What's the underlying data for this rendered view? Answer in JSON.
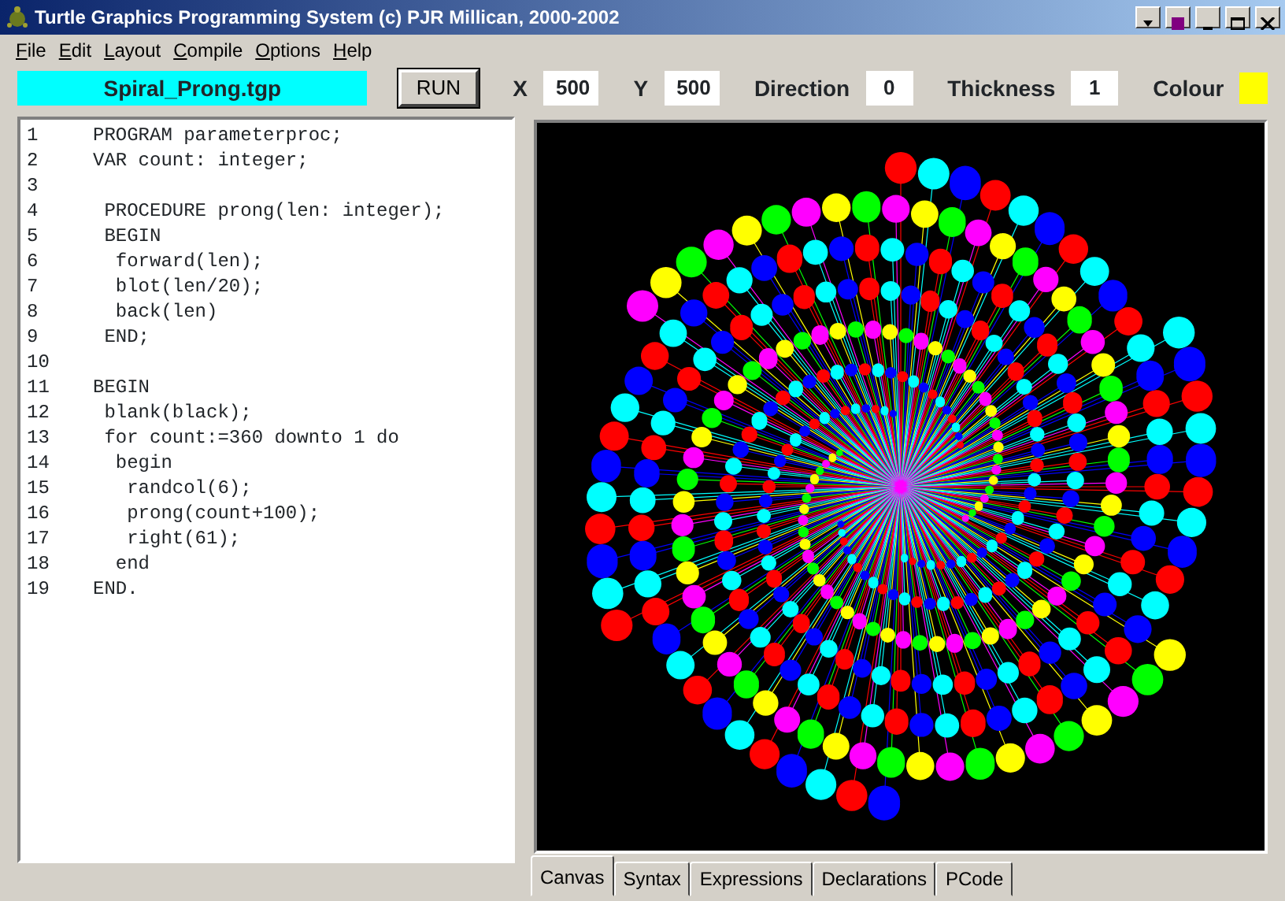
{
  "window": {
    "title": "Turtle Graphics Programming System  (c) PJR Millican, 2000-2002"
  },
  "menu": [
    "File",
    "Edit",
    "Layout",
    "Compile",
    "Options",
    "Help"
  ],
  "toolbar": {
    "filename": "Spiral_Prong.tgp",
    "run_button": "RUN",
    "fields": [
      {
        "label": "X",
        "value": "500"
      },
      {
        "label": "Y",
        "value": "500"
      },
      {
        "label": "Direction",
        "value": "0"
      },
      {
        "label": "Thickness",
        "value": "1"
      }
    ],
    "colour": {
      "label": "Colour",
      "color": "#ffff00"
    }
  },
  "editor": {
    "lines": [
      {
        "number": "1",
        "code": "PROGRAM parameterproc;"
      },
      {
        "number": "2",
        "code": "VAR count: integer;"
      },
      {
        "number": "3"
      },
      {
        "number": "4",
        "code": " PROCEDURE prong(len: integer);"
      },
      {
        "number": "5",
        "code": " BEGIN"
      },
      {
        "number": "6",
        "code": "  forward(len);"
      },
      {
        "number": "7",
        "code": "  blot(len/20);"
      },
      {
        "number": "8",
        "code": "  back(len)"
      },
      {
        "number": "9",
        "code": " END;"
      },
      {
        "number": "10"
      },
      {
        "number": "11",
        "code": "BEGIN"
      },
      {
        "number": "12",
        "code": " blank(black);"
      },
      {
        "number": "13",
        "code": " for count:=360 downto 1 do"
      },
      {
        "number": "14",
        "code": "  begin"
      },
      {
        "number": "15",
        "code": "   randcol(6);"
      },
      {
        "number": "16",
        "code": "   prong(count+100);"
      },
      {
        "number": "17",
        "code": "   right(61);"
      },
      {
        "number": "18",
        "code": "  end"
      },
      {
        "number": "19",
        "code": "END."
      }
    ]
  },
  "tabs": [
    {
      "label": "Canvas",
      "selected": true
    },
    {
      "label": "Syntax",
      "selected": false
    },
    {
      "label": "Expressions",
      "selected": false
    },
    {
      "label": "Declarations",
      "selected": false
    },
    {
      "label": "PCode",
      "selected": false
    }
  ]
}
